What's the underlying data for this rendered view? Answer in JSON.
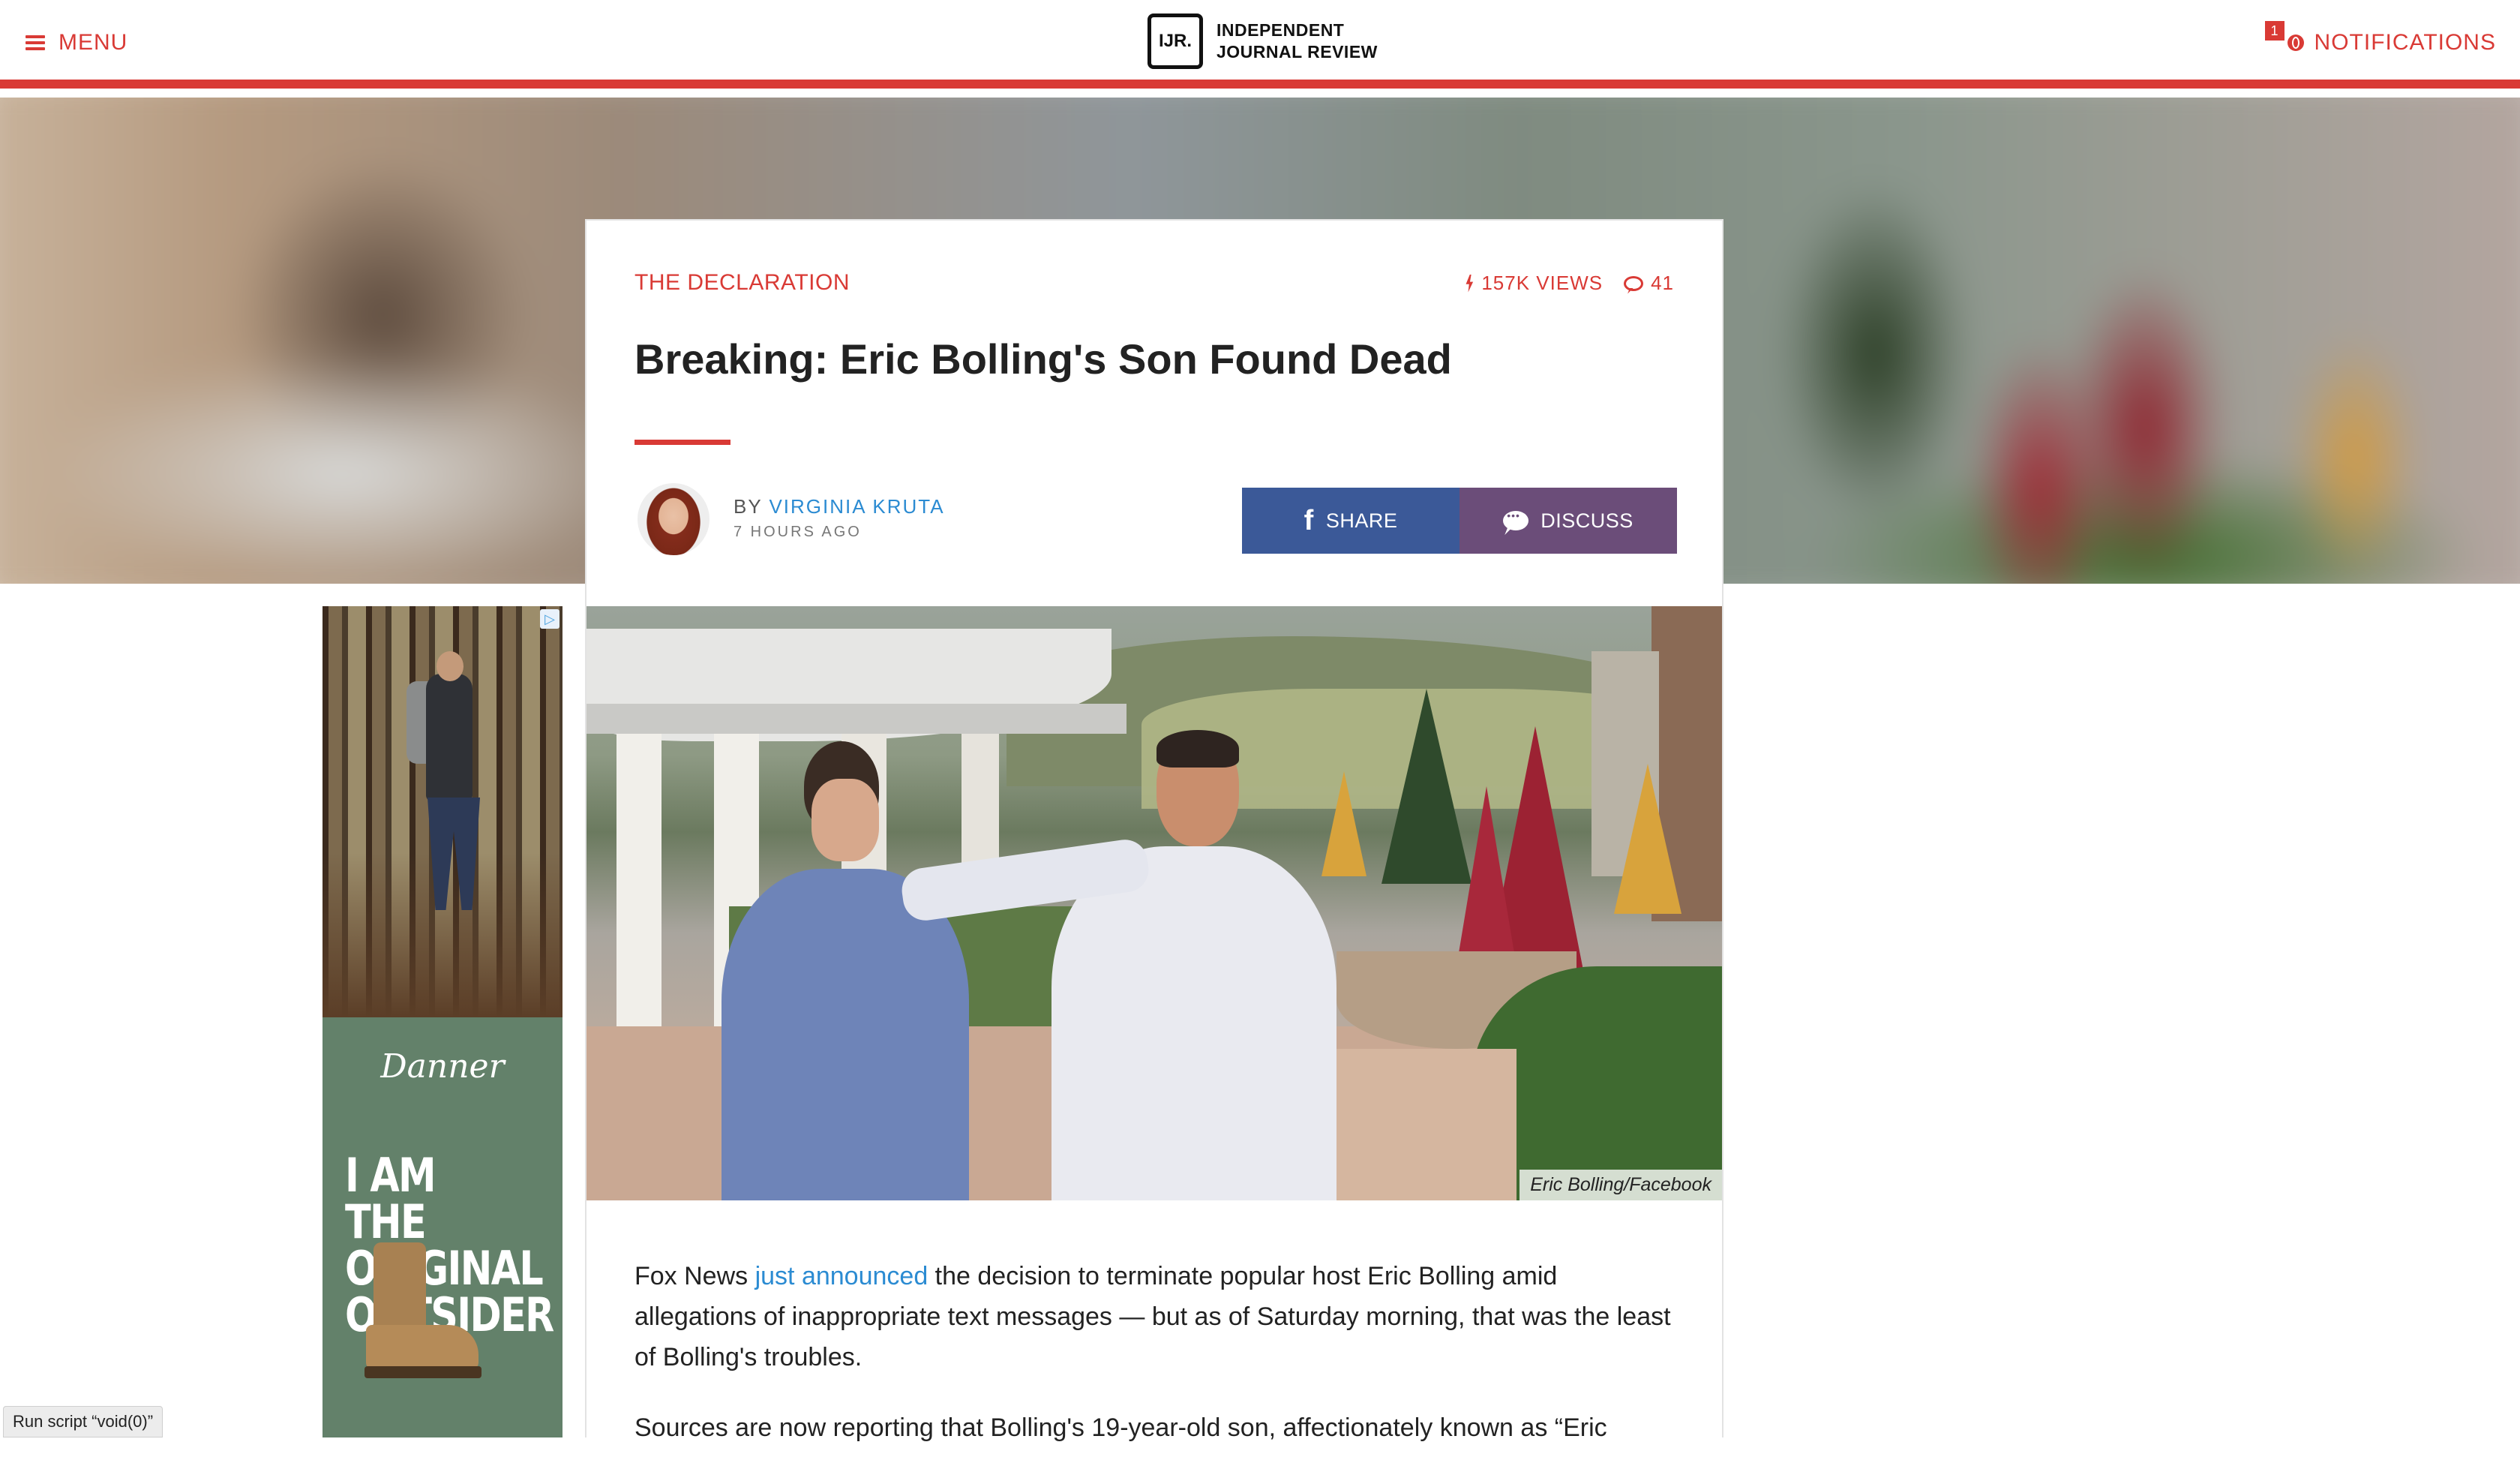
{
  "nav": {
    "menu_label": "MENU",
    "logo_mark": "IJR.",
    "logo_line1": "INDEPENDENT",
    "logo_line2": "JOURNAL REVIEW",
    "notifications_label": "NOTIFICATIONS",
    "notifications_count": "1",
    "accent_color": "#d93a35"
  },
  "ad": {
    "brand": "Danner",
    "headline_lines": [
      "I AM THE",
      "ORIGINAL",
      "OUTSIDER"
    ],
    "info_icon": "ad-choices-icon"
  },
  "article": {
    "kicker": "THE DECLARATION",
    "views": "157K VIEWS",
    "comments": "41",
    "headline": "Breaking: Eric Bolling's Son Found Dead",
    "by_prefix": "BY",
    "author": "VIRGINIA KRUTA",
    "time_ago": "7 HOURS AGO",
    "share_label": "SHARE",
    "discuss_label": "DISCUSS",
    "share_color": "#3b5998",
    "discuss_color": "#6b4d79",
    "photo_caption": "Eric Bolling/Facebook",
    "paragraph1": {
      "before_link": "Fox News ",
      "link_text": "just announced",
      "after_link": " the decision to terminate popular host Eric Bolling amid allegations of inappropriate text messages — but as of Saturday morning, that was the least of Bolling's troubles."
    },
    "paragraph2_start": "Sources are now reporting that Bolling's 19-year-old son, affectionately known as “Eric"
  },
  "status_bar": "Run script “void(0)”"
}
